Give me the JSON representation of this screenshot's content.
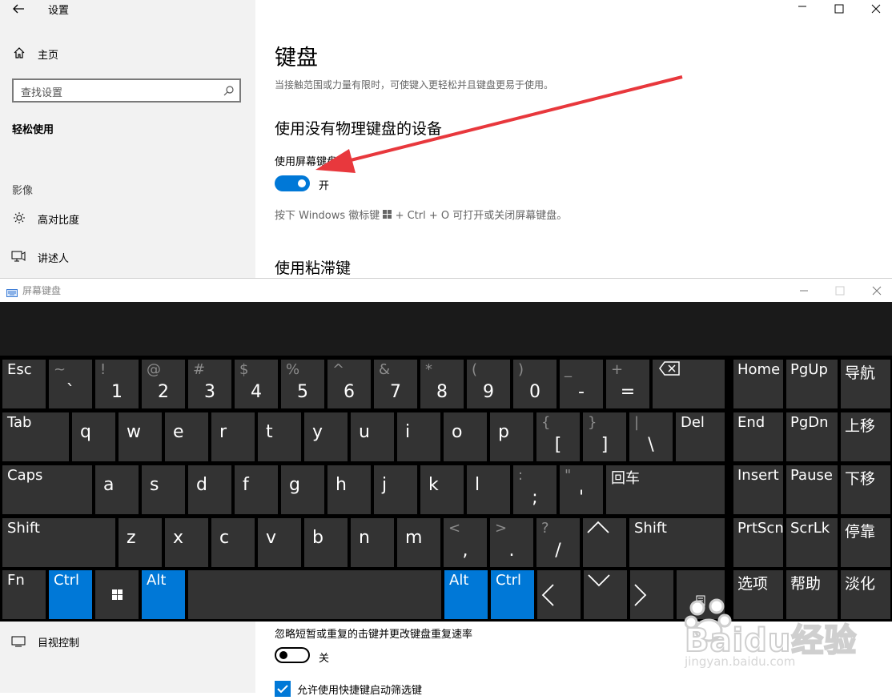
{
  "window": {
    "title": "设置"
  },
  "sidebar": {
    "home_label": "主页",
    "search_placeholder": "查找设置",
    "section_title": "轻松使用",
    "group_label": "影像",
    "items": [
      {
        "label": "高对比度",
        "icon": "sun-icon"
      },
      {
        "label": "讲述人",
        "icon": "narrator-icon"
      },
      {
        "label": "目视控制",
        "icon": "eye-control-icon"
      }
    ]
  },
  "main": {
    "page_title": "键盘",
    "page_description": "当接触范围或力量有限时，可使键入更轻松并且键盘更易于使用。",
    "section1_heading": "使用没有物理键盘的设备",
    "osk_toggle_label": "使用屏幕键盘",
    "osk_toggle_state": "开",
    "shortcut_hint_prefix": "按下 Windows 徽标键 ",
    "shortcut_hint_suffix": " + Ctrl + O 可打开或关闭屏幕键盘。",
    "section2_heading": "使用粘滞键",
    "filter_keys_label": "忽略短暂或重复的击键并更改键盘重复速率",
    "filter_keys_state": "关",
    "filter_shortcut_label": "允许使用快捷键启动筛选键"
  },
  "osk": {
    "title": "屏幕键盘",
    "rows": [
      [
        {
          "top": "Esc",
          "topdim": false
        },
        {
          "top": "~",
          "bot": "`"
        },
        {
          "top": "!",
          "bot": "1"
        },
        {
          "top": "@",
          "bot": "2"
        },
        {
          "top": "#",
          "bot": "3"
        },
        {
          "top": "$",
          "bot": "4"
        },
        {
          "top": "%",
          "bot": "5"
        },
        {
          "top": "^",
          "bot": "6"
        },
        {
          "top": "&",
          "bot": "7"
        },
        {
          "top": "*",
          "bot": "8"
        },
        {
          "top": "(",
          "bot": "9"
        },
        {
          "top": ")",
          "bot": "0"
        },
        {
          "top": "_",
          "bot": "-"
        },
        {
          "top": "+",
          "bot": "="
        },
        {
          "icon": "backspace-icon"
        }
      ],
      [
        {
          "top": "Tab"
        },
        {
          "lower": "q"
        },
        {
          "lower": "w"
        },
        {
          "lower": "e"
        },
        {
          "lower": "r"
        },
        {
          "lower": "t"
        },
        {
          "lower": "y"
        },
        {
          "lower": "u"
        },
        {
          "lower": "i"
        },
        {
          "lower": "o"
        },
        {
          "lower": "p"
        },
        {
          "top": "{",
          "bot": "["
        },
        {
          "top": "}",
          "bot": "]"
        },
        {
          "top": "|",
          "bot": "\\"
        },
        {
          "top": "Del"
        }
      ],
      [
        {
          "top": "Caps"
        },
        {
          "lower": "a"
        },
        {
          "lower": "s"
        },
        {
          "lower": "d"
        },
        {
          "lower": "f"
        },
        {
          "lower": "g"
        },
        {
          "lower": "h"
        },
        {
          "lower": "j"
        },
        {
          "lower": "k"
        },
        {
          "lower": "l"
        },
        {
          "top": ":",
          "bot": ";"
        },
        {
          "top": "\"",
          "bot": "'"
        },
        {
          "top": "回车"
        }
      ],
      [
        {
          "top": "Shift"
        },
        {
          "lower": "z"
        },
        {
          "lower": "x"
        },
        {
          "lower": "c"
        },
        {
          "lower": "v"
        },
        {
          "lower": "b"
        },
        {
          "lower": "n"
        },
        {
          "lower": "m"
        },
        {
          "top": "<",
          "bot": ","
        },
        {
          "top": ">",
          "bot": "."
        },
        {
          "top": "?",
          "bot": "/"
        },
        {
          "icon": "up-arrow-icon"
        },
        {
          "top": "Shift"
        }
      ],
      [
        {
          "top": "Fn"
        },
        {
          "top": "Ctrl",
          "blue": true
        },
        {
          "icon": "windows-logo-icon"
        },
        {
          "top": "Alt",
          "blue": true
        },
        {
          "space": true
        },
        {
          "top": "Alt",
          "blue": true
        },
        {
          "top": "Ctrl",
          "blue": true
        },
        {
          "icon": "left-arrow-icon"
        },
        {
          "icon": "down-arrow-icon"
        },
        {
          "icon": "right-arrow-icon"
        },
        {
          "icon": "context-menu-icon"
        }
      ]
    ],
    "nav_rows": [
      [
        "Home",
        "PgUp",
        "导航"
      ],
      [
        "End",
        "PgDn",
        "上移"
      ],
      [
        "Insert",
        "Pause",
        "下移"
      ],
      [
        "PrtScn",
        "ScrLk",
        "停靠"
      ],
      [
        "选项",
        "帮助",
        "淡化"
      ]
    ]
  },
  "watermark": {
    "brand": "Baidu经验",
    "url": "jingyan.baidu.com"
  },
  "colors": {
    "accent": "#0078d7",
    "osk_key": "#333333",
    "osk_bg": "#000000",
    "annotation_arrow": "#e8383d"
  }
}
